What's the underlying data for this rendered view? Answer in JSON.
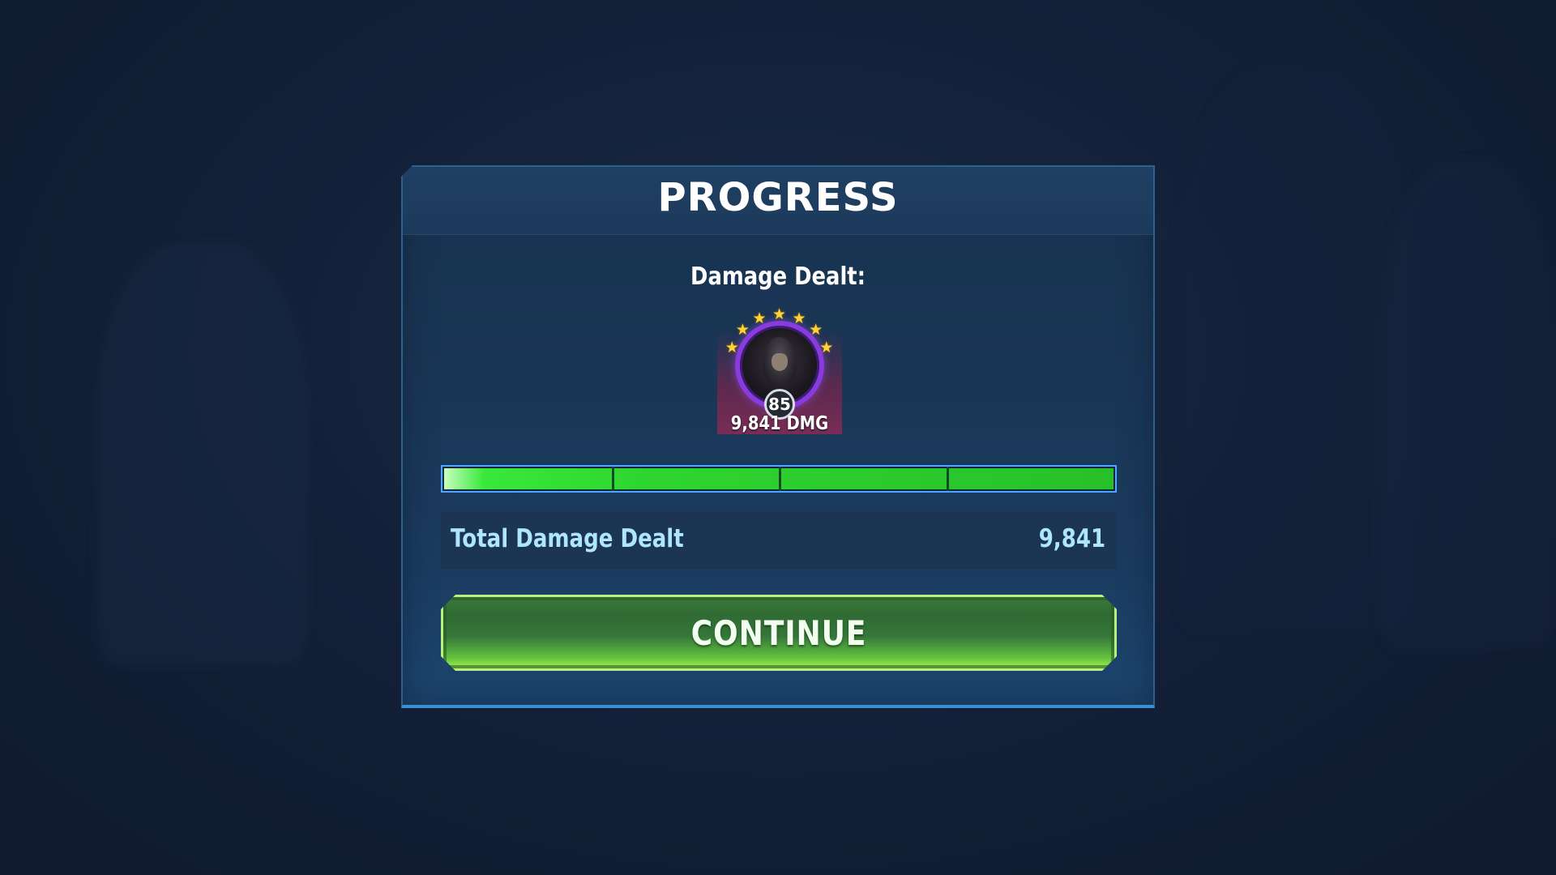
{
  "panel": {
    "title": "PROGRESS",
    "damage_label": "Damage Dealt:"
  },
  "character": {
    "level": "85",
    "stars": 7,
    "damage_text": "9,841 DMG",
    "ring_color": "#8a3be0"
  },
  "progress_bar": {
    "fill_fraction": 1.0,
    "segments": 4,
    "fill_color": "#2fd52f"
  },
  "total": {
    "label": "Total Damage Dealt",
    "value": "9,841"
  },
  "continue_button": {
    "label": "CONTINUE"
  }
}
